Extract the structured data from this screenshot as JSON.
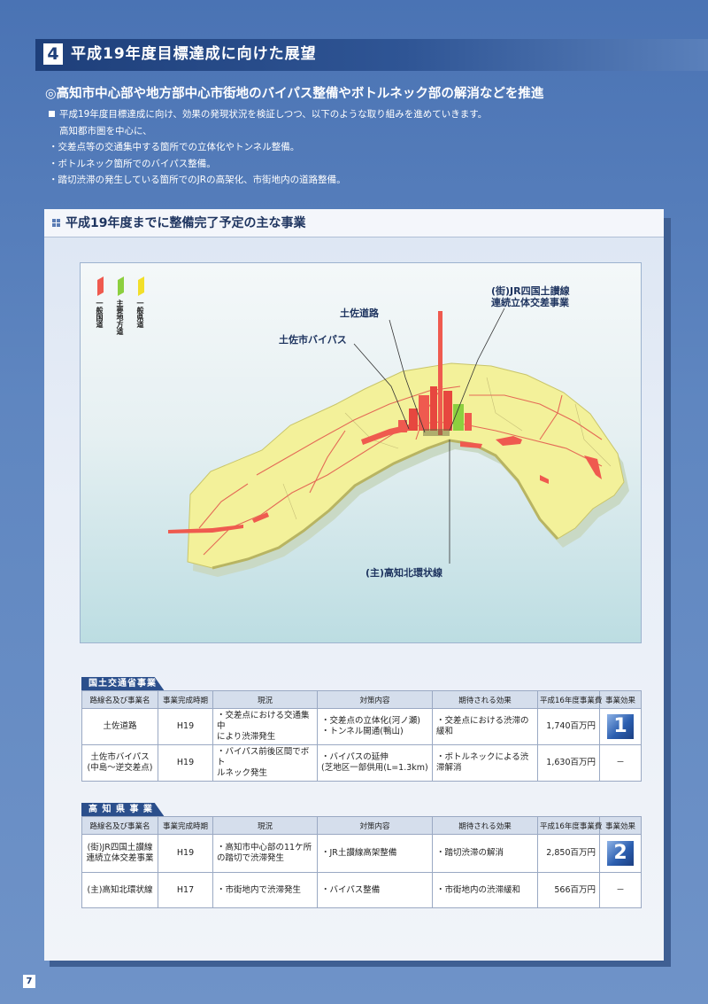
{
  "section": {
    "number": "4",
    "title": "平成19年度目標達成に向けた展望"
  },
  "subheading": "◎高知市中心部や地方部中心市街地のバイパス整備やボトルネック部の解消などを推進",
  "intro": {
    "line1": "平成19年度目標達成に向け、効果の発現状況を検証しつつ、以下のような取り組みを進めていきます。",
    "line2": "高知都市圏を中心に、",
    "bullets": [
      "・交差点等の交通集中する箇所での立体化やトンネル整備。",
      "・ボトルネック箇所でのバイパス整備。",
      "・踏切渋滞の発生している箇所でのJRの高架化、市街地内の道路整備。"
    ]
  },
  "panel_title": "平成19年度までに整備完了予定の主な事業",
  "map": {
    "legend": [
      {
        "label": "一般国道",
        "color": "#ef5a4f"
      },
      {
        "label": "主要地方道",
        "color": "#8ccf3f"
      },
      {
        "label": "一般県道",
        "color": "#f2df2a"
      }
    ],
    "callouts": {
      "jr": "(街)JR四国土讃線\n連続立体交差事業",
      "tosa_road": "土佐道路",
      "tosa_bypass": "土佐市バイパス",
      "kita_loop": "(主)高知北環状線"
    }
  },
  "headers": [
    "路線名及び事業名",
    "事業完成時期",
    "現況",
    "対策内容",
    "期待される効果",
    "平成16年度事業費",
    "事業効果"
  ],
  "mlit": {
    "tag": "国土交通省事業",
    "rows": [
      {
        "name": "土佐道路",
        "year": "H19",
        "status": "・交差点における交通集中\nにより渋滞発生",
        "measure": "・交差点の立体化(河ノ瀬)\n・トンネル開通(鴨山)",
        "effect": "・交差点における渋滞の緩和",
        "cost": "1,740百万円",
        "badge": "1"
      },
      {
        "name": "土佐市バイパス\n(中島～逆交差点)",
        "year": "H19",
        "status": "・バイパス前後区間でボト\nルネック発生",
        "measure": "・バイパスの延伸\n(芝地区一部供用(L=1.3km)",
        "effect": "・ボトルネックによる渋滞解消",
        "cost": "1,630百万円",
        "badge": "－"
      }
    ]
  },
  "pref": {
    "tag": "高 知 県 事 業",
    "rows": [
      {
        "name": "(街)JR四国土讃線\n連続立体交差事業",
        "year": "H19",
        "status": "・高知市中心部の11ケ所\nの踏切で渋滞発生",
        "measure": "・JR土讃線高架整備",
        "effect": "・踏切渋滞の解消",
        "cost": "2,850百万円",
        "badge": "2"
      },
      {
        "name": "(主)高知北環状線",
        "year": "H17",
        "status": "・市街地内で渋滞発生",
        "measure": "・バイパス整備",
        "effect": "・市街地内の渋滞緩和",
        "cost": "566百万円",
        "badge": "－"
      }
    ]
  },
  "page_number": "7"
}
